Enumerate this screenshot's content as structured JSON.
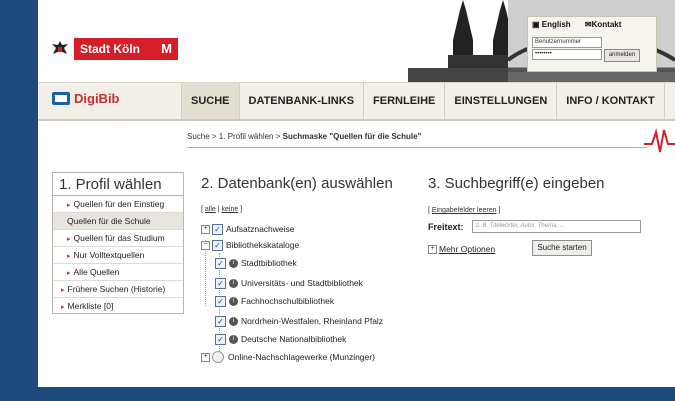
{
  "header": {
    "city_label": "Stadt Köln",
    "login": {
      "lang_english": "English",
      "lang_contact": "Kontakt",
      "id_field_value": "Benutzernummer",
      "password_field_value": "••••••••",
      "login_button": "anmelden"
    }
  },
  "navbar": {
    "brand": "DigiBib",
    "tabs": [
      {
        "label": "SUCHE",
        "active": true
      },
      {
        "label": "DATENBANK-LINKS"
      },
      {
        "label": "FERNLEIHE"
      },
      {
        "label": "EINSTELLUNGEN"
      },
      {
        "label": "INFO / KONTAKT"
      }
    ]
  },
  "breadcrumb": {
    "prefix": "Suche > 1. Profil wählen > ",
    "current": "Suchmaske \"Quellen für die Schule\""
  },
  "step1": {
    "title": "1. Profil wählen",
    "items": [
      {
        "label": "Quellen für den Einstieg"
      },
      {
        "label": "Quellen für die Schule",
        "active": true
      },
      {
        "label": "Quellen für das Studium"
      },
      {
        "label": "Nur Volltextquellen"
      },
      {
        "label": "Alle Quellen"
      },
      {
        "label": "Frühere Suchen (Historie)"
      },
      {
        "label": "Merkliste [0]"
      }
    ]
  },
  "step2": {
    "title": "2. Datenbank(en) auswählen",
    "select_all": "alle",
    "select_none": "keine",
    "tree": [
      {
        "label": "Aufsatznachweise"
      },
      {
        "label": "Bibliothekskataloge"
      },
      {
        "label": "Stadtbibliothek"
      },
      {
        "label": "Universitäts- und Stadtbibliothek"
      },
      {
        "label": "Fachhochschulbibliothek"
      },
      {
        "label": "Nordrhein-Westfalen, Rheinland Pfalz"
      },
      {
        "label": "Deutsche Nationalbibliothek"
      },
      {
        "label": "Online-Nachschlagewerke (Munzinger)"
      }
    ]
  },
  "step3": {
    "title": "3. Suchbegriff(e) eingeben",
    "reset_link": "Eingabefelder leeren",
    "freetext_label": "Freitext:",
    "freetext_placeholder": "z. B. Titelwörter, Autor, Thema, ...",
    "more_options": "Mehr Optionen",
    "search_button": "Suche starten"
  },
  "colors": {
    "frame_blue": "#1f4a7d",
    "accent_red": "#d41f2b",
    "nav_bg": "#f1efe8"
  }
}
